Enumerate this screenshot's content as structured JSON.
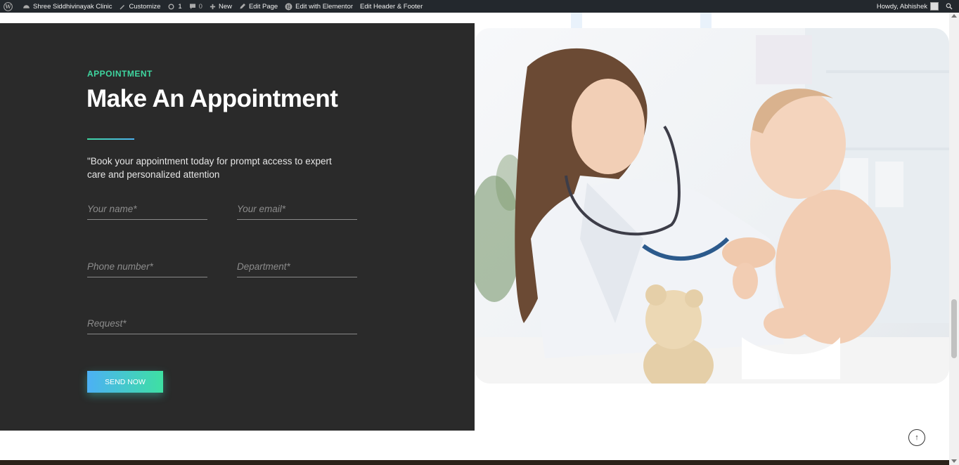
{
  "admin_bar": {
    "site_name": "Shree Siddhivinayak Clinic",
    "customize": "Customize",
    "updates_count": "1",
    "comments_count": "0",
    "new": "New",
    "edit_page": "Edit Page",
    "edit_elementor": "Edit with Elementor",
    "edit_header_footer": "Edit Header & Footer",
    "howdy": "Howdy, Abhishek"
  },
  "appointment": {
    "eyebrow": "APPOINTMENT",
    "heading": "Make An Appointment",
    "description": "\"Book your appointment today for prompt access to expert care and personalized attention",
    "form": {
      "name_placeholder": "Your name*",
      "email_placeholder": "Your email*",
      "phone_placeholder": "Phone number*",
      "department_placeholder": "Department*",
      "request_placeholder": "Request*",
      "submit_label": "SEND NOW"
    }
  },
  "colors": {
    "accent_green": "#3fd6a0",
    "accent_blue": "#4db3f2",
    "panel_bg": "#2a2a2a",
    "admin_bar_bg": "#23282d"
  },
  "icons": [
    "wordpress-logo-icon",
    "dashboard-icon",
    "brush-icon",
    "refresh-icon",
    "comment-icon",
    "plus-icon",
    "pencil-icon",
    "elementor-icon",
    "search-icon",
    "arrow-up-icon"
  ]
}
